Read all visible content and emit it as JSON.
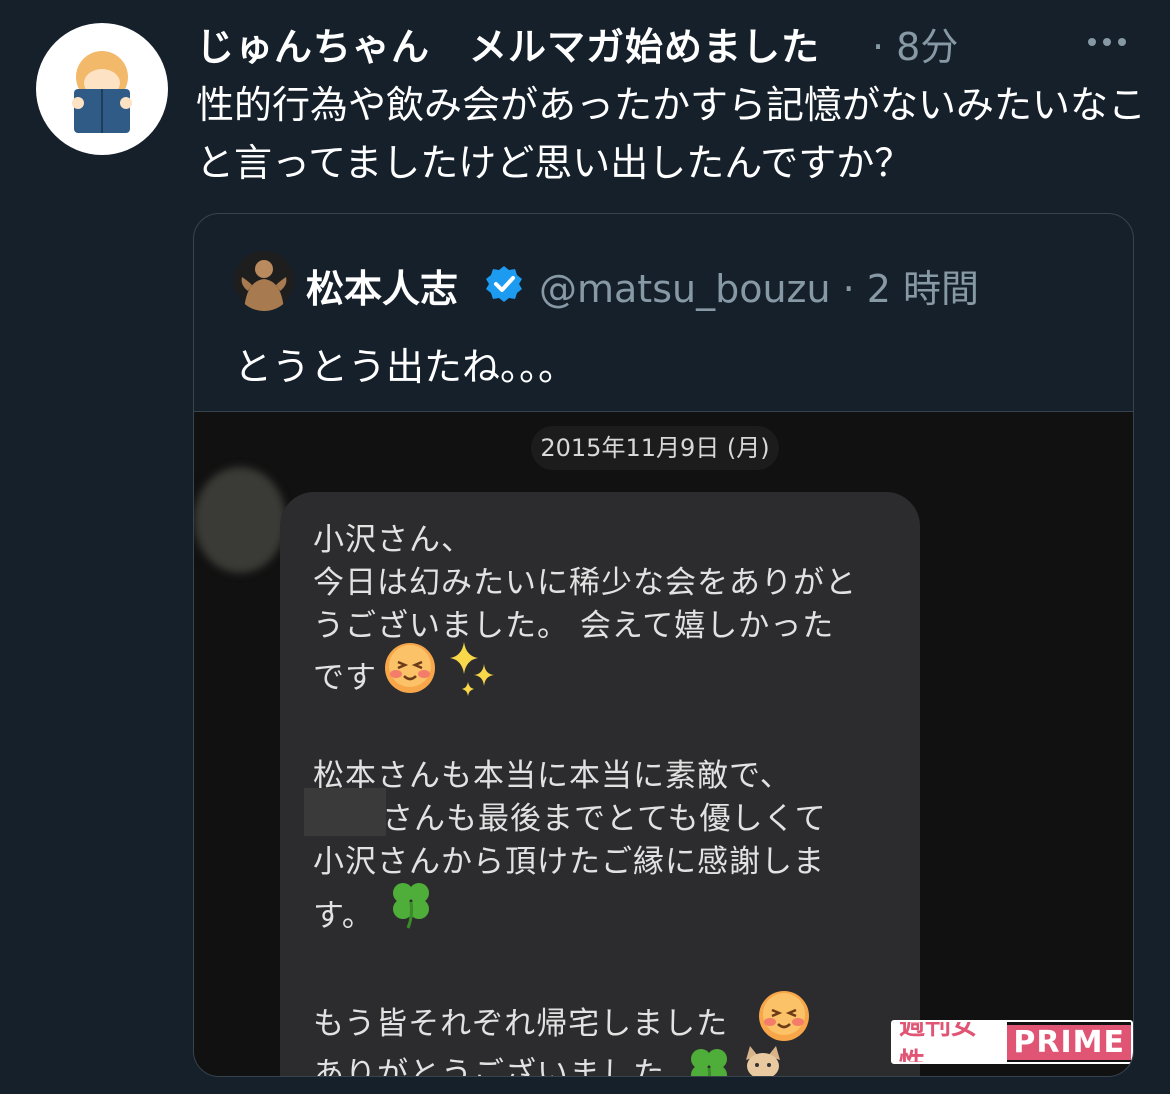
{
  "tweet": {
    "author_name": "じゅんちゃん　メルマガ始めました",
    "time": "· 8分",
    "text": "性的行為や飲み会があったかすら記憶がないみたいなこと言ってましたけど思い出したんですか？",
    "more_icon": "more-horizontal-icon"
  },
  "quote": {
    "name": "松本人志",
    "handle_time": "@matsu_bouzu · 2 時間",
    "text": "とうとう出たね。。。",
    "verified_icon": "verified-badge-icon"
  },
  "screenshot": {
    "date": "2015年11月9日 (月)",
    "message_lines": [
      "小沢さん、",
      "今日は幻みたいに稀少な会をありがと",
      "うございました。 会えて嬉しかった",
      "です",
      "松本さんも本当に本当に素敵で、",
      "さんも最後までとても優しくて",
      "小沢さんから頂けたご縁に感謝しま",
      "す。",
      "もう皆それぞれ帰宅しました",
      "ありがとうございました"
    ],
    "watermark_left": "週刊女性",
    "watermark_right": "PRIME"
  },
  "colors": {
    "background": "#15202b",
    "secondary_text": "#8899a6",
    "verified": "#1d9bf0",
    "watermark": "#e05574"
  }
}
